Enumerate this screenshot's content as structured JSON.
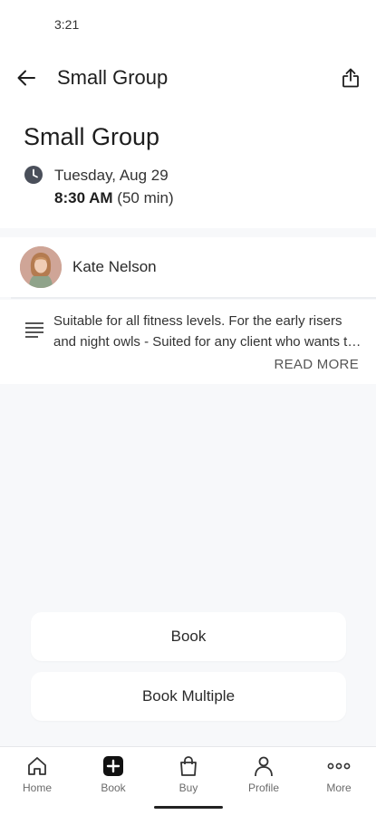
{
  "status_bar": {
    "time": "3:21"
  },
  "app_bar": {
    "title": "Small Group"
  },
  "class_info": {
    "title": "Small Group",
    "date": "Tuesday, Aug 29",
    "time": "8:30 AM",
    "duration": "(50 min)"
  },
  "instructor": {
    "name": "Kate Nelson"
  },
  "description": {
    "text": "Suitable for all fitness levels. For the early risers and night owls - Suited for any client who wants to train on their schedule.",
    "read_more": "READ MORE"
  },
  "actions": {
    "book": "Book",
    "book_multiple": "Book Multiple"
  },
  "bottom_nav": [
    {
      "label": "Home",
      "icon": "home-icon"
    },
    {
      "label": "Book",
      "icon": "plus-square-icon"
    },
    {
      "label": "Buy",
      "icon": "shopping-bag-icon"
    },
    {
      "label": "Profile",
      "icon": "person-icon"
    },
    {
      "label": "More",
      "icon": "more-dots-icon"
    }
  ],
  "colors": {
    "background": "#f7f8fa",
    "surface": "#ffffff",
    "text_primary": "#1e1e1e",
    "icon_dark": "#4a4f5a"
  }
}
